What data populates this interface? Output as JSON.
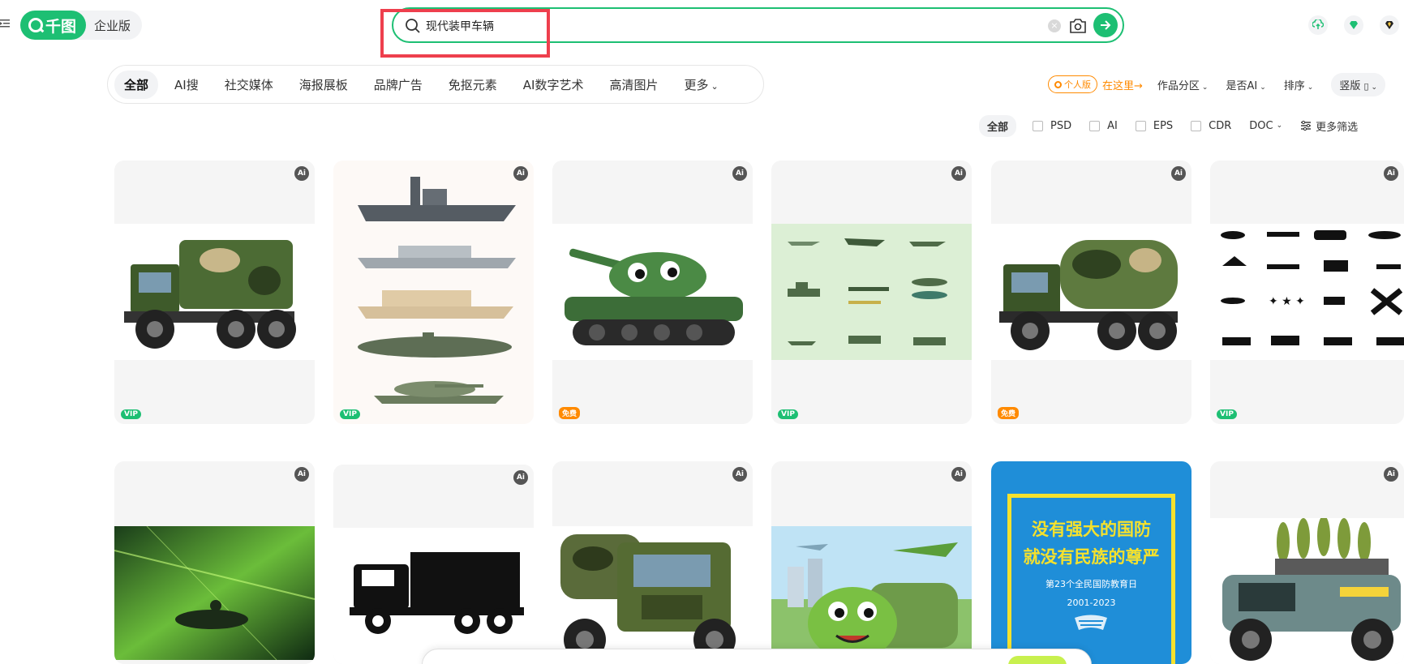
{
  "header": {
    "logo_text": "千图",
    "edition_label": "企业版",
    "search": {
      "value": "现代装甲车辆",
      "placeholder": ""
    },
    "clear_symbol": "×"
  },
  "category_nav": {
    "items": [
      {
        "label": "全部",
        "active": true
      },
      {
        "label": "AI搜",
        "active": false
      },
      {
        "label": "社交媒体",
        "active": false
      },
      {
        "label": "海报展板",
        "active": false
      },
      {
        "label": "品牌广告",
        "active": false
      },
      {
        "label": "免抠元素",
        "active": false
      },
      {
        "label": "AI数字艺术",
        "active": false
      },
      {
        "label": "高清图片",
        "active": false
      }
    ],
    "more_label": "更多"
  },
  "right_filters": {
    "personal_badge": "个人版",
    "here_link": "在这里→",
    "zone_label": "作品分区",
    "is_ai_label": "是否AI",
    "sort_label": "排序",
    "vertical_label": "竖版"
  },
  "format_filters": {
    "all_label": "全部",
    "options": [
      "PSD",
      "AI",
      "EPS",
      "CDR"
    ],
    "doc_label": "DOC",
    "more_filter_label": "更多筛选"
  },
  "cards": [
    {
      "alt": "military truck",
      "ai_badge": "Ai",
      "tag": "VIP",
      "tag_type": "vip"
    },
    {
      "alt": "warships and tank",
      "ai_badge": "Ai",
      "tag": "VIP",
      "tag_type": "vip"
    },
    {
      "alt": "cartoon tank",
      "ai_badge": "Ai",
      "tag": "免费",
      "tag_type": "free"
    },
    {
      "alt": "military vehicles set",
      "ai_badge": "Ai",
      "tag": "VIP",
      "tag_type": "vip"
    },
    {
      "alt": "camouflage truck",
      "ai_badge": "Ai",
      "tag": "免费",
      "tag_type": "free"
    },
    {
      "alt": "silhouette weapons",
      "ai_badge": "Ai",
      "tag": "VIP",
      "tag_type": "vip"
    },
    {
      "alt": "green futuristic vehicle",
      "ai_badge": "Ai",
      "tag": "",
      "tag_type": ""
    },
    {
      "alt": "black truck silhouette",
      "ai_badge": "Ai",
      "tag": "",
      "tag_type": ""
    },
    {
      "alt": "camouflage truck front",
      "ai_badge": "Ai",
      "tag": "",
      "tag_type": ""
    },
    {
      "alt": "cartoon military truck",
      "ai_badge": "Ai",
      "tag": "",
      "tag_type": ""
    },
    {
      "alt": "defense poster",
      "ai_badge": "",
      "tag": "",
      "tag_type": ""
    },
    {
      "alt": "rocket launcher vehicle",
      "ai_badge": "Ai",
      "tag": "",
      "tag_type": ""
    }
  ],
  "poster": {
    "line1": "没有强大的国防",
    "line2": "就没有民族的尊严",
    "subtitle": "第23个全民国防教育日",
    "years": "2001-2023"
  },
  "colors": {
    "brand_green": "#1dbf73",
    "accent_orange": "#ff8a00",
    "highlight_red": "#ee3f4d"
  }
}
